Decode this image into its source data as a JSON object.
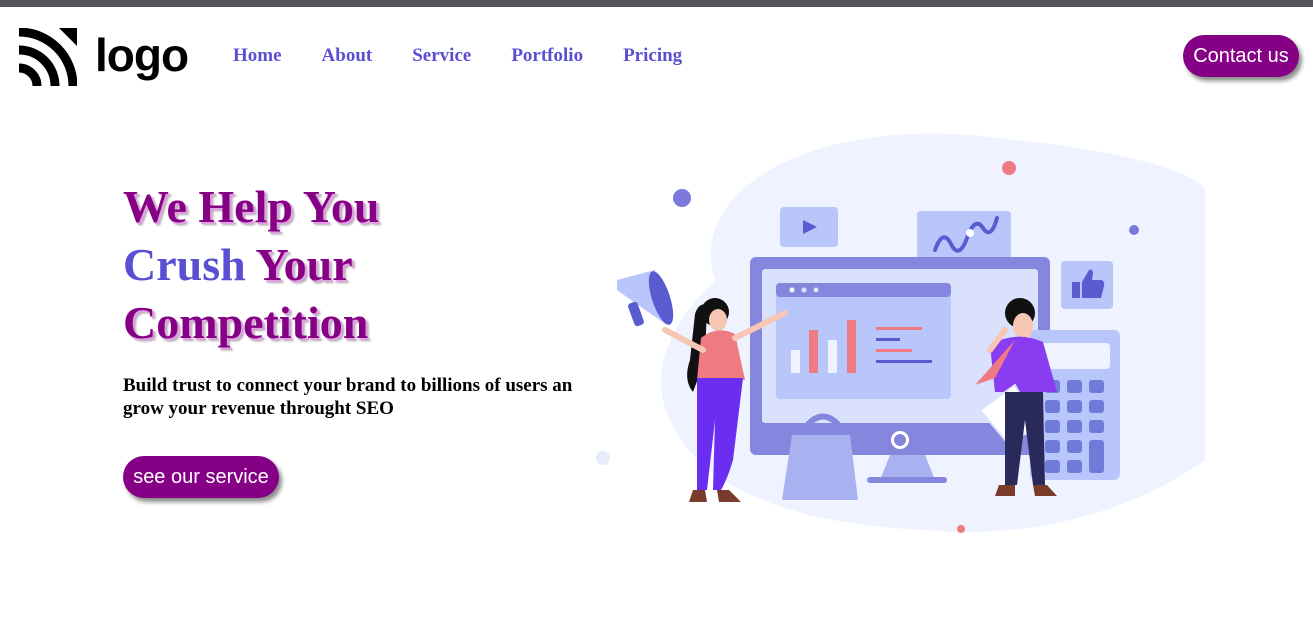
{
  "brand": {
    "logo_text": "logo"
  },
  "nav": {
    "items": [
      {
        "label": "Home"
      },
      {
        "label": "About"
      },
      {
        "label": "Service"
      },
      {
        "label": "Portfolio"
      },
      {
        "label": "Pricing"
      }
    ]
  },
  "header": {
    "contact_label": "Contact us"
  },
  "hero": {
    "line1": "We Help You",
    "line2_accent": "Crush",
    "line2_rest": " Your",
    "line3": "Competition",
    "description": "Build trust to connect your brand to billions of users an grow your revenue throught SEO",
    "cta_label": "see our service"
  },
  "colors": {
    "brand_purple": "#860086",
    "accent_indigo": "#5a4fd2",
    "illustration_blob": "#eef3ff"
  }
}
